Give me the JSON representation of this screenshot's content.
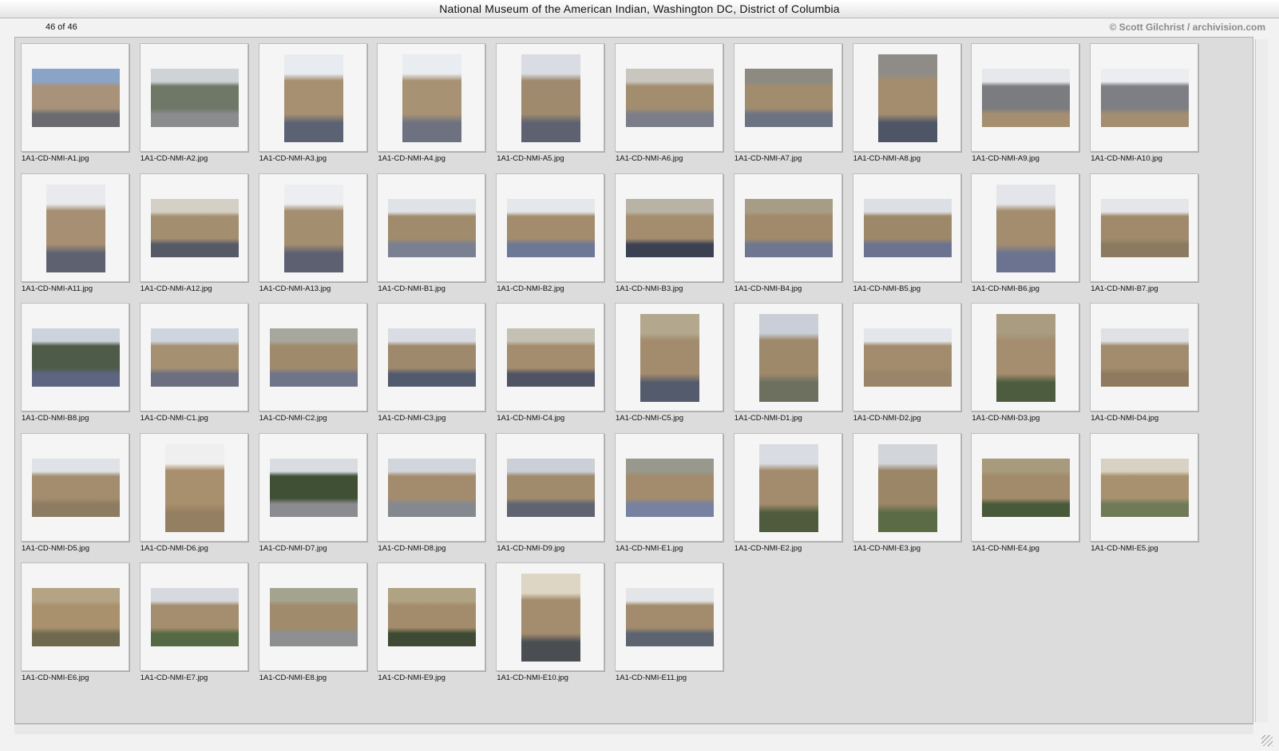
{
  "window": {
    "title": "National Museum of the American Indian, Washington DC, District of Columbia"
  },
  "status": {
    "counter": "46 of 46",
    "credit": "© Scott Gilchrist / archivision.com"
  },
  "thumbnails": [
    {
      "file": "1A1-CD-NMI-A1.jpg",
      "orientation": "landscape",
      "sky": "#8aa4c8",
      "building": "#a8937a",
      "ground": "#6a6a70"
    },
    {
      "file": "1A1-CD-NMI-A2.jpg",
      "orientation": "landscape",
      "sky": "#cfd3d6",
      "building": "#6f7867",
      "ground": "#8a8c8e"
    },
    {
      "file": "1A1-CD-NMI-A3.jpg",
      "orientation": "portrait",
      "sky": "#e8ebf0",
      "building": "#a78f72",
      "ground": "#5b6273"
    },
    {
      "file": "1A1-CD-NMI-A4.jpg",
      "orientation": "portrait",
      "sky": "#e9ecf0",
      "building": "#a89274",
      "ground": "#6e7180"
    },
    {
      "file": "1A1-CD-NMI-A5.jpg",
      "orientation": "portrait",
      "sky": "#d9dce2",
      "building": "#9f8a6e",
      "ground": "#5d6170"
    },
    {
      "file": "1A1-CD-NMI-A6.jpg",
      "orientation": "landscape",
      "sky": "#c9c6bf",
      "building": "#a38d6f",
      "ground": "#7b7e88"
    },
    {
      "file": "1A1-CD-NMI-A7.jpg",
      "orientation": "landscape",
      "sky": "#8d8a82",
      "building": "#a18c6d",
      "ground": "#6b7383"
    },
    {
      "file": "1A1-CD-NMI-A8.jpg",
      "orientation": "portrait",
      "sky": "#8f8c88",
      "building": "#a48d6f",
      "ground": "#4d5566"
    },
    {
      "file": "1A1-CD-NMI-A9.jpg",
      "orientation": "landscape",
      "sky": "#e6e8ec",
      "building": "#7b7c80",
      "ground": "#a58f70"
    },
    {
      "file": "1A1-CD-NMI-A10.jpg",
      "orientation": "landscape",
      "sky": "#ecedf0",
      "building": "#7e7f84",
      "ground": "#a48e71"
    },
    {
      "file": "1A1-CD-NMI-A11.jpg",
      "orientation": "portrait",
      "sky": "#e9eaee",
      "building": "#a68f72",
      "ground": "#5e6270"
    },
    {
      "file": "1A1-CD-NMI-A12.jpg",
      "orientation": "landscape",
      "sky": "#d5d0c6",
      "building": "#a48e70",
      "ground": "#555a66"
    },
    {
      "file": "1A1-CD-NMI-A13.jpg",
      "orientation": "portrait",
      "sky": "#eceef1",
      "building": "#a48e70",
      "ground": "#5c6070"
    },
    {
      "file": "1A1-CD-NMI-B1.jpg",
      "orientation": "landscape",
      "sky": "#dfe3e8",
      "building": "#a18b6d",
      "ground": "#7a8092"
    },
    {
      "file": "1A1-CD-NMI-B2.jpg",
      "orientation": "landscape",
      "sky": "#e4e7eb",
      "building": "#a38c6e",
      "ground": "#6d7796"
    },
    {
      "file": "1A1-CD-NMI-B3.jpg",
      "orientation": "landscape",
      "sky": "#b9b3a6",
      "building": "#a48d6f",
      "ground": "#3c4152"
    },
    {
      "file": "1A1-CD-NMI-B4.jpg",
      "orientation": "landscape",
      "sky": "#a79c86",
      "building": "#a18a6b",
      "ground": "#6e7690"
    },
    {
      "file": "1A1-CD-NMI-B5.jpg",
      "orientation": "landscape",
      "sky": "#dcdfe4",
      "building": "#9d8869",
      "ground": "#6b7390"
    },
    {
      "file": "1A1-CD-NMI-B6.jpg",
      "orientation": "portrait",
      "sky": "#e3e5ea",
      "building": "#a48d6f",
      "ground": "#6c7390"
    },
    {
      "file": "1A1-CD-NMI-B7.jpg",
      "orientation": "landscape",
      "sky": "#e4e6ea",
      "building": "#a08a6b",
      "ground": "#8b7a60"
    },
    {
      "file": "1A1-CD-NMI-B8.jpg",
      "orientation": "landscape",
      "sky": "#cdd3dc",
      "building": "#4f5b49",
      "ground": "#5d6580"
    },
    {
      "file": "1A1-CD-NMI-C1.jpg",
      "orientation": "landscape",
      "sky": "#cfd5de",
      "building": "#a69072",
      "ground": "#6b6f7f"
    },
    {
      "file": "1A1-CD-NMI-C2.jpg",
      "orientation": "landscape",
      "sky": "#a7a79e",
      "building": "#a08a6c",
      "ground": "#6f7589"
    },
    {
      "file": "1A1-CD-NMI-C3.jpg",
      "orientation": "landscape",
      "sky": "#d9dde3",
      "building": "#9e896c",
      "ground": "#525a6e"
    },
    {
      "file": "1A1-CD-NMI-C4.jpg",
      "orientation": "landscape",
      "sky": "#c4c0b4",
      "building": "#a48d6e",
      "ground": "#4f5364"
    },
    {
      "file": "1A1-CD-NMI-C5.jpg",
      "orientation": "portrait",
      "sky": "#b3a88e",
      "building": "#a38c6d",
      "ground": "#545b6c"
    },
    {
      "file": "1A1-CD-NMI-D1.jpg",
      "orientation": "portrait",
      "sky": "#c9ced8",
      "building": "#9f896b",
      "ground": "#6d705f"
    },
    {
      "file": "1A1-CD-NMI-D2.jpg",
      "orientation": "landscape",
      "sky": "#e3e6ea",
      "building": "#a38c6d",
      "ground": "#9a846a"
    },
    {
      "file": "1A1-CD-NMI-D3.jpg",
      "orientation": "portrait",
      "sky": "#a99c80",
      "building": "#a58e6f",
      "ground": "#4d5c3e"
    },
    {
      "file": "1A1-CD-NMI-D4.jpg",
      "orientation": "landscape",
      "sky": "#dfe1e5",
      "building": "#a28c6d",
      "ground": "#8f7a5f"
    },
    {
      "file": "1A1-CD-NMI-D5.jpg",
      "orientation": "landscape",
      "sky": "#dfe2e7",
      "building": "#a48d6f",
      "ground": "#8d7b62"
    },
    {
      "file": "1A1-CD-NMI-D6.jpg",
      "orientation": "portrait",
      "sky": "#efefef",
      "building": "#a88f6d",
      "ground": "#957f62"
    },
    {
      "file": "1A1-CD-NMI-D7.jpg",
      "orientation": "landscape",
      "sky": "#d9dde2",
      "building": "#3f5035",
      "ground": "#8b8c90"
    },
    {
      "file": "1A1-CD-NMI-D8.jpg",
      "orientation": "landscape",
      "sky": "#d1d5dc",
      "building": "#a38c6e",
      "ground": "#86888f"
    },
    {
      "file": "1A1-CD-NMI-D9.jpg",
      "orientation": "landscape",
      "sky": "#cbd0d8",
      "building": "#a18b6d",
      "ground": "#5f6470"
    },
    {
      "file": "1A1-CD-NMI-E1.jpg",
      "orientation": "landscape",
      "sky": "#98998c",
      "building": "#a28c6d",
      "ground": "#7782a0"
    },
    {
      "file": "1A1-CD-NMI-E2.jpg",
      "orientation": "portrait",
      "sky": "#d9dce2",
      "building": "#a38c6d",
      "ground": "#4e5b3c"
    },
    {
      "file": "1A1-CD-NMI-E3.jpg",
      "orientation": "portrait",
      "sky": "#d2d5da",
      "building": "#9b8668",
      "ground": "#5a6b45"
    },
    {
      "file": "1A1-CD-NMI-E4.jpg",
      "orientation": "landscape",
      "sky": "#a89a7d",
      "building": "#a28b6b",
      "ground": "#495a3a"
    },
    {
      "file": "1A1-CD-NMI-E5.jpg",
      "orientation": "landscape",
      "sky": "#d8d2c2",
      "building": "#a8916f",
      "ground": "#6f7a56"
    },
    {
      "file": "1A1-CD-NMI-E6.jpg",
      "orientation": "landscape",
      "sky": "#b4a485",
      "building": "#a9916d",
      "ground": "#6f6a4f"
    },
    {
      "file": "1A1-CD-NMI-E7.jpg",
      "orientation": "landscape",
      "sky": "#d6d9de",
      "building": "#a58e6f",
      "ground": "#556a44"
    },
    {
      "file": "1A1-CD-NMI-E8.jpg",
      "orientation": "landscape",
      "sky": "#a4a38f",
      "building": "#a08b6c",
      "ground": "#8e8f91"
    },
    {
      "file": "1A1-CD-NMI-E9.jpg",
      "orientation": "landscape",
      "sky": "#b0a383",
      "building": "#a38c6c",
      "ground": "#3e4a33"
    },
    {
      "file": "1A1-CD-NMI-E10.jpg",
      "orientation": "portrait",
      "sky": "#ddd6c5",
      "building": "#a48d6e",
      "ground": "#4a4d52"
    },
    {
      "file": "1A1-CD-NMI-E11.jpg",
      "orientation": "landscape",
      "sky": "#e3e5e9",
      "building": "#a38c6d",
      "ground": "#5d6470"
    }
  ]
}
